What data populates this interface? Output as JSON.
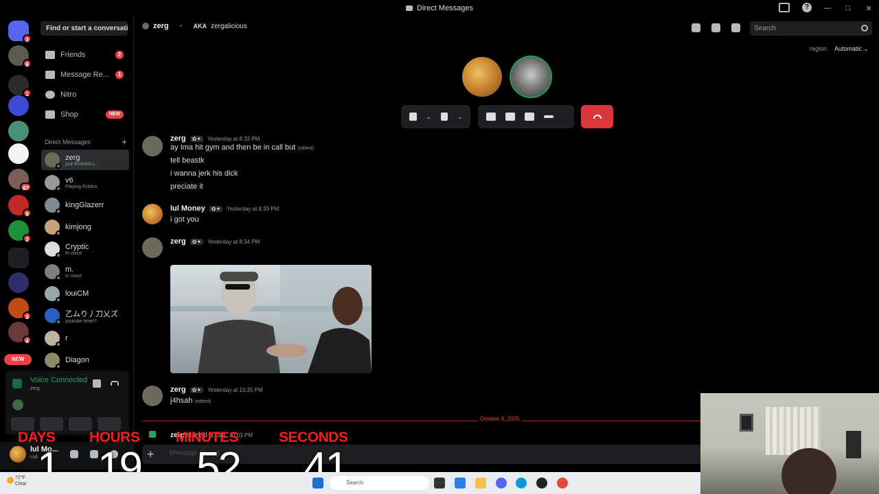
{
  "window": {
    "title": "Direct Messages",
    "help_glyph": "?",
    "controls": [
      "—",
      "□",
      "✕"
    ]
  },
  "rail": {
    "servers": [
      {
        "icon": "discord-home-icon",
        "color": "#5865f2",
        "badge": "3"
      },
      {
        "icon": "server-avatar",
        "color": "#5b5b4e",
        "badge": "6"
      },
      {
        "icon": "server-avatar",
        "color": "#2b2b2b",
        "badge": "1"
      },
      {
        "icon": "server-avatar",
        "color": "#3c4bd6",
        "badge": ""
      },
      {
        "icon": "server-avatar",
        "color": "#4a8f78",
        "badge": ""
      },
      {
        "icon": "server-avatar",
        "color": "#f4f4f4",
        "badge": ""
      },
      {
        "icon": "server-avatar",
        "color": "#7a5f57",
        "badge": "87"
      },
      {
        "icon": "server-avatar",
        "color": "#c22a2a",
        "badge": "9"
      },
      {
        "icon": "server-avatar",
        "color": "#1f8f3a",
        "badge": "2"
      },
      {
        "icon": "folder-icon",
        "color": "#3a3fd6",
        "badge": ""
      },
      {
        "icon": "server-avatar",
        "color": "#2e2e6a",
        "badge": ""
      },
      {
        "icon": "server-avatar",
        "color": "#c04b14",
        "badge": "3"
      },
      {
        "icon": "server-avatar",
        "color": "#6a3a3a",
        "badge": "4"
      }
    ],
    "new_label": "NEW"
  },
  "sidebar": {
    "search_placeholder": "Find or start a conversation",
    "nav": [
      {
        "label": "Friends",
        "count": "2"
      },
      {
        "label": "Message Re...",
        "count": "1"
      },
      {
        "label": "Nitro",
        "count": ""
      },
      {
        "label": "Shop",
        "badge": "NEW"
      }
    ],
    "dm_header": "Direct Messages",
    "dms": [
      {
        "name": "zerg",
        "status": "just finished u...",
        "online": true,
        "color": "#6e6a5a",
        "active": true
      },
      {
        "name": "v6",
        "status": "Playing Roblox",
        "online": true,
        "color": "#9a9a9a"
      },
      {
        "name": "kingGlazerr",
        "status": "",
        "online": false,
        "color": "#7d8a90"
      },
      {
        "name": "kimjong",
        "status": "",
        "online": false,
        "color": "#c4a27c"
      },
      {
        "name": "Cryptic",
        "status": "In voice",
        "online": true,
        "color": "#ddd"
      },
      {
        "name": "m.",
        "status": "In voice",
        "online": true,
        "color": "#7f7e7a"
      },
      {
        "name": "louiCM",
        "status": "",
        "online": false,
        "color": "#9aa6ae"
      },
      {
        "name": "乙ムり丿刀乂ズ",
        "status": "youtube time!!!",
        "online": true,
        "color": "#2a5fc4"
      },
      {
        "name": "r",
        "status": "",
        "online": false,
        "color": "#c0b2a0"
      },
      {
        "name": "Diagon",
        "status": "",
        "online": false,
        "color": "#8b8b6a"
      }
    ]
  },
  "voice": {
    "title": "Voice Connected",
    "subtitle": "zerg"
  },
  "user_panel": {
    "name": "lul Mo...",
    "sub": "call"
  },
  "header": {
    "username": "zerg",
    "aka_label": "AKA",
    "alias": "zergalicious",
    "search_placeholder": "Search",
    "region_label": "region",
    "region_value": "Automatic ⌄"
  },
  "messages": [
    {
      "author": "zerg",
      "time": "Yesterday at 8:33 PM",
      "lines": [
        "ay Ima hit gym and then be in call but",
        "tell beastk",
        "i wanna jerk his dick",
        "preciate it"
      ],
      "edited_first": "(edited)"
    },
    {
      "author": "lul Money",
      "time": "Yesterday at 8:33 PM",
      "lines": [
        "i got you"
      ]
    },
    {
      "author": "zerg",
      "time": "Yesterday at 8:34 PM",
      "lines": []
    },
    {
      "author": "zerg",
      "time": "Yesterday at 10:35 PM",
      "lines": [
        "j4hsah"
      ],
      "edited": "(edited)"
    }
  ],
  "divider_date": "October 4, 2025",
  "system_msg": {
    "author": "zerg",
    "text": "started a call.",
    "time": "10:03 PM"
  },
  "input_placeholder": "Message @zerg",
  "countdown": {
    "days_label": "DAYS",
    "days": "1",
    "hours_label": "HOURS",
    "hours": "19",
    "minutes_label": "MINUTES",
    "minutes": "52",
    "seconds_label": "SECONDS",
    "seconds": "41"
  },
  "taskbar": {
    "temp": "72°F",
    "condition": "Clear",
    "search": "Search"
  }
}
